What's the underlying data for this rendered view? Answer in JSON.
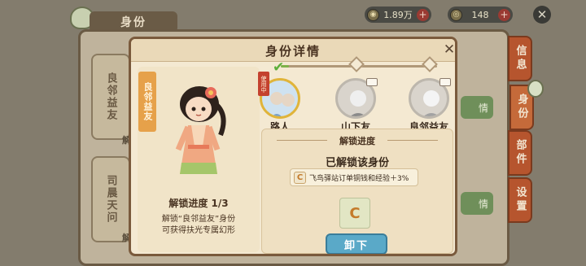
{
  "background": {
    "panel_title": "身份",
    "cards": [
      "良邻益友",
      "司晨天问"
    ],
    "card_buttons": [
      "情",
      "情"
    ],
    "card_hints": [
      "解",
      "解"
    ]
  },
  "currency": [
    {
      "icon": "copper-coin-icon",
      "value": "1.89万"
    },
    {
      "icon": "jade-coin-icon",
      "value": "148"
    }
  ],
  "side_tabs": [
    "信息",
    "身份",
    "部件",
    "设置"
  ],
  "modal": {
    "title": "身份详情",
    "character_name": "良邻益友",
    "unlock_count": "解锁进度 1/3",
    "unlock_desc_line1": "解锁“良邻益友”身份",
    "unlock_desc_line2": "可获得扶光专属幻形",
    "progress_fraction": 0.05,
    "using_tag": "使用中",
    "roles": [
      {
        "name": "路人",
        "active": true
      },
      {
        "name": "山下友",
        "active": false
      },
      {
        "name": "良邻益友",
        "active": false
      }
    ],
    "info_header": "解锁进度",
    "unlocked_label": "已解锁该身份",
    "perk_text": "飞鸟驿站订单铜钱和经验＋3%",
    "unequip_label": "卸下"
  },
  "colors": {
    "modal_bg": "#f4e9d2",
    "accent_orange": "#e6a14a",
    "button_blue": "#5aa9c8",
    "progress_green": "#7fb24a",
    "side_tab": "#b6552e"
  }
}
